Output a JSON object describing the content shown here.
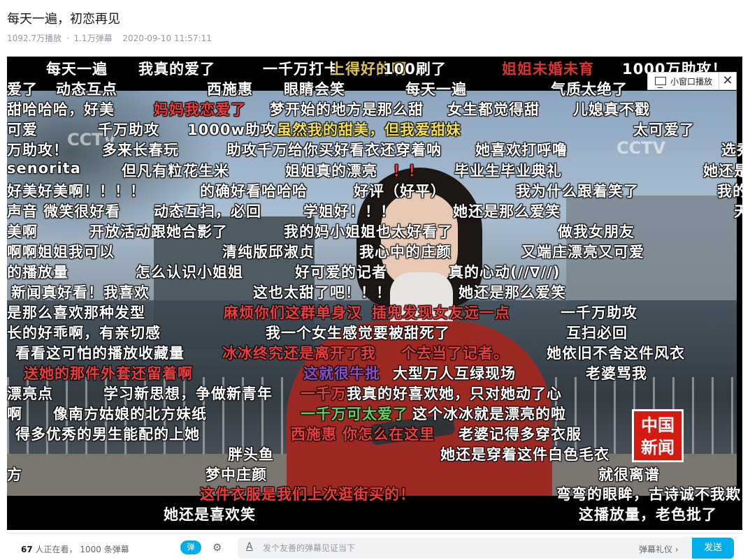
{
  "page": {
    "title": "每天一遍，初恋再见",
    "play_count": "1092.7万播放",
    "separator": "·",
    "danmaku_count": "1.1万弹幕",
    "date": "2020-09-10 11:57:11"
  },
  "player": {
    "mini_window_label": "小窗口播放",
    "close_label": "✕",
    "watermark_left": "CCTV",
    "watermark_right": "CCTV",
    "news_logo": "中国新闻",
    "danmaku": [
      {
        "text": "每天一遍",
        "color": "#ffffff"
      },
      {
        "text": "我真的爱了",
        "color": "#ffffff"
      },
      {
        "text": "一千万打卡",
        "color": "#ffffff"
      },
      {
        "text": "上得好的啊",
        "color": "#e0c34a"
      },
      {
        "text": "100刷了",
        "color": "#ffffff"
      },
      {
        "text": "姐姐未婚未育",
        "color": "#e03030"
      },
      {
        "text": "1000万助攻！",
        "color": "#ffffff"
      },
      {
        "text": "爱了",
        "color": "#ffffff"
      },
      {
        "text": "动态互点",
        "color": "#ffffff"
      },
      {
        "text": "西施惠",
        "color": "#ffffff"
      },
      {
        "text": "眼睛会笑",
        "color": "#ffffff"
      },
      {
        "text": "每天一遍",
        "color": "#ffffff"
      },
      {
        "text": "气质太绝了",
        "color": "#ffffff"
      },
      {
        "text": "甜哈哈哈，好美",
        "color": "#ffffff"
      },
      {
        "text": "妈妈我恋爱了",
        "color": "#f03c3c"
      },
      {
        "text": "梦开始的地方是那么甜",
        "color": "#ffffff"
      },
      {
        "text": "女生都觉得甜",
        "color": "#ffffff"
      },
      {
        "text": "儿媳真不戳",
        "color": "#ffffff"
      },
      {
        "text": "可爱",
        "color": "#ffffff"
      },
      {
        "text": "千万助攻",
        "color": "#ffffff"
      },
      {
        "text": "1000w助攻",
        "color": "#ffffff"
      },
      {
        "text": "虽然我的甜美，但我爱甜妹",
        "color": "#f4e04d"
      },
      {
        "text": "太可爱了",
        "color": "#ffffff"
      },
      {
        "text": "万助攻！",
        "color": "#ffffff"
      },
      {
        "text": "多来长春玩",
        "color": "#ffffff"
      },
      {
        "text": "助攻千万给你买好看衣还穿着呐",
        "color": "#ffffff"
      },
      {
        "text": "她喜欢打呼噜",
        "color": "#ffffff"
      },
      {
        "text": "选秀出道",
        "color": "#ffffff"
      },
      {
        "text": "senorita",
        "color": "#ffffff"
      },
      {
        "text": "但凡有粒花生米",
        "color": "#ffffff"
      },
      {
        "text": "姐姐真的漂亮",
        "color": "#ffffff"
      },
      {
        "text": "！！",
        "color": "#f03c3c"
      },
      {
        "text": "毕业生毕业典礼",
        "color": "#ffffff"
      },
      {
        "text": "她还是",
        "color": "#ffffff"
      },
      {
        "text": "好美好美啊！！！！",
        "color": "#ffffff"
      },
      {
        "text": "的确好看哈哈哈",
        "color": "#ffffff"
      },
      {
        "text": "好评（好平）",
        "color": "#ffffff"
      },
      {
        "text": "我为什么跟着笑了",
        "color": "#ffffff"
      },
      {
        "text": "我的",
        "color": "#ffffff"
      },
      {
        "text": "声音 微笑很好看",
        "color": "#ffffff"
      },
      {
        "text": "动态互扫，必回",
        "color": "#ffffff"
      },
      {
        "text": "学姐好！！！",
        "color": "#ffffff"
      },
      {
        "text": "她还是那么爱笑",
        "color": "#ffffff"
      },
      {
        "text": "天",
        "color": "#ffffff"
      },
      {
        "text": "美啊",
        "color": "#ffffff"
      },
      {
        "text": "开放活动跟她合影了",
        "color": "#ffffff"
      },
      {
        "text": "我的妈小姐姐也太好看了",
        "color": "#ffffff"
      },
      {
        "text": "做我女朋友",
        "color": "#ffffff"
      },
      {
        "text": "啊啊姐姐我可以",
        "color": "#ffffff"
      },
      {
        "text": "清纯版邱淑贞",
        "color": "#ffffff"
      },
      {
        "text": "我心中的庄颜",
        "color": "#ffffff"
      },
      {
        "text": "又端庄漂亮又可爱",
        "color": "#ffffff"
      },
      {
        "text": "的播放量",
        "color": "#ffffff"
      },
      {
        "text": "怎么认识小姐姐",
        "color": "#ffffff"
      },
      {
        "text": "好可爱的记者",
        "color": "#ffffff"
      },
      {
        "text": "真的心动(//∇//)",
        "color": "#ffffff"
      },
      {
        "text": "新闻真好看！我喜欢",
        "color": "#ffffff"
      },
      {
        "text": "这也太甜了吧！！！",
        "color": "#ffffff"
      },
      {
        "text": "她还是那么爱笑",
        "color": "#ffffff"
      },
      {
        "text": "是那么喜欢那种发型",
        "color": "#ffffff"
      },
      {
        "text": "麻烦你们这群单身汉",
        "color": "#f03c3c"
      },
      {
        "text": "插兜发现女友远一点",
        "color": "#f03c3c"
      },
      {
        "text": "一千万助攻",
        "color": "#ffffff"
      },
      {
        "text": "长的好乖啊，有亲切感",
        "color": "#ffffff"
      },
      {
        "text": "我一个女生感觉要被甜死了",
        "color": "#ffffff"
      },
      {
        "text": "互扫必回",
        "color": "#ffffff"
      },
      {
        "text": "看看这可怕的播放收藏量",
        "color": "#ffffff"
      },
      {
        "text": "冰冰终究还是离开了我",
        "color": "#f03c3c"
      },
      {
        "text": "个去当了记者。",
        "color": "#f03c3c"
      },
      {
        "text": "她依旧不舍这件风衣",
        "color": "#ffffff"
      },
      {
        "text": "送她的那件外套还留着啊",
        "color": "#f03c3c"
      },
      {
        "text": "这就很牛批",
        "color": "#8a4fc8"
      },
      {
        "text": "大型万人互绿现场",
        "color": "#ffffff"
      },
      {
        "text": "老婆骂我",
        "color": "#ffffff"
      },
      {
        "text": "漂亮点",
        "color": "#ffffff"
      },
      {
        "text": "学习新思想，争做新青年",
        "color": "#ffffff"
      },
      {
        "text": "一千万",
        "color": "#f03c3c"
      },
      {
        "text": "我真的好喜欢她，只对她动了心",
        "color": "#ffffff"
      },
      {
        "text": "啊",
        "color": "#ffffff"
      },
      {
        "text": "像南方姑娘的北方妹纸",
        "color": "#ffffff"
      },
      {
        "text": "一千万可太爱了",
        "color": "#5fd25f"
      },
      {
        "text": "这个冰冰就是漂亮的啦",
        "color": "#ffffff"
      },
      {
        "text": "得多优秀的男生能配的上她",
        "color": "#ffffff"
      },
      {
        "text": "西施惠 你怎么在这里",
        "color": "#f03c3c"
      },
      {
        "text": "老婆记得多穿衣服",
        "color": "#ffffff"
      },
      {
        "text": "胖头鱼",
        "color": "#ffffff"
      },
      {
        "text": "她还是穿着这件白色毛衣",
        "color": "#ffffff"
      },
      {
        "text": "方",
        "color": "#ffffff"
      },
      {
        "text": "梦中庄颜",
        "color": "#ffffff"
      },
      {
        "text": "就很离谱",
        "color": "#ffffff"
      },
      {
        "text": "这件衣服是我们上次逛街买的！",
        "color": "#f03c3c"
      },
      {
        "text": "弯弯的眼眸，古诗诚不我欺",
        "color": "#ffffff"
      },
      {
        "text": "她还是喜欢笑",
        "color": "#ffffff"
      },
      {
        "text": "这播放量，老色批了",
        "color": "#ffffff"
      }
    ]
  },
  "bottom_bar": {
    "viewers_count": "67",
    "viewers_suffix": "人正在看，",
    "danmaku_total": "1000 条弹幕",
    "toggle_label": "弹",
    "settings_icon": "⚙",
    "font_icon": "A",
    "input_placeholder": "发个友善的弹幕见证当下",
    "etiquette_label": "弹幕礼仪 ›",
    "send_label": "发送"
  }
}
